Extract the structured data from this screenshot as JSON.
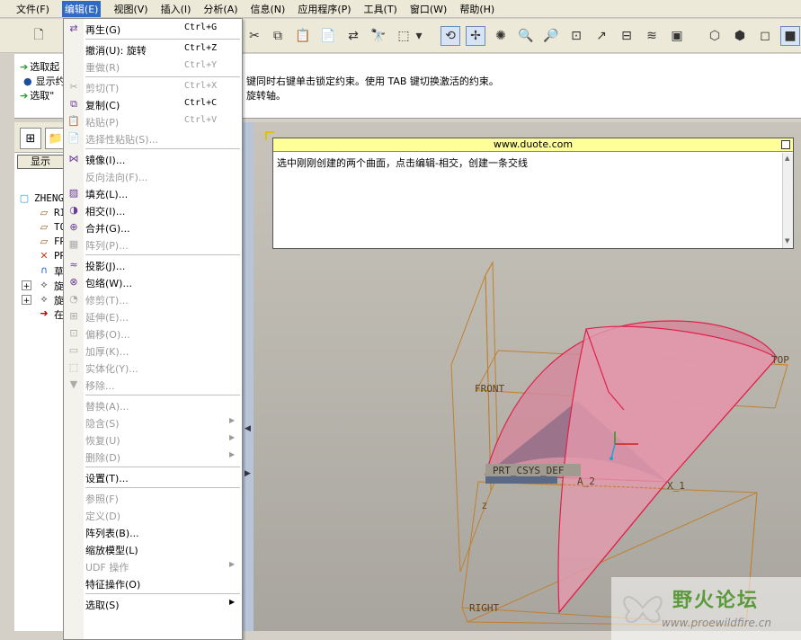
{
  "menubar": {
    "items": [
      "文件(F)",
      "编辑(E)",
      "视图(V)",
      "插入(I)",
      "分析(A)",
      "信息(N)",
      "应用程序(P)",
      "工具(T)",
      "窗口(W)",
      "帮助(H)"
    ],
    "active_index": 1
  },
  "messages": {
    "line1": "选取起",
    "line2": "显示约",
    "line2_tail": "键同时右键单击锁定约束。使用 TAB 键切换激活的约束。",
    "line3": "选取\"",
    "line3_tail": "旋转轴。"
  },
  "left_panel": {
    "show_button": "显示",
    "tree": [
      {
        "label": "ZHENG",
        "icon": "part-icon"
      },
      {
        "label": "RI",
        "icon": "datum-plane-icon"
      },
      {
        "label": "TO",
        "icon": "datum-plane-icon"
      },
      {
        "label": "FR",
        "icon": "datum-plane-icon"
      },
      {
        "label": "PR",
        "icon": "csys-icon"
      },
      {
        "label": "草",
        "icon": "sketch-icon"
      },
      {
        "label": "旋",
        "icon": "revolve-icon"
      },
      {
        "label": "旋",
        "icon": "revolve-icon"
      },
      {
        "label": "在",
        "icon": "insert-here-icon"
      }
    ]
  },
  "edit_menu": {
    "items": [
      {
        "label": "再生(G)",
        "shortcut": "Ctrl+G",
        "enabled": true,
        "icon": "regenerate-icon"
      },
      {
        "separator": true
      },
      {
        "label": "撤消(U):  旋转",
        "shortcut": "Ctrl+Z",
        "enabled": true,
        "icon": ""
      },
      {
        "label": "重做(R)",
        "shortcut": "Ctrl+Y",
        "enabled": false,
        "icon": ""
      },
      {
        "separator": true
      },
      {
        "label": "剪切(T)",
        "shortcut": "Ctrl+X",
        "enabled": false,
        "icon": "cut-icon"
      },
      {
        "label": "复制(C)",
        "shortcut": "Ctrl+C",
        "enabled": true,
        "icon": "copy-icon"
      },
      {
        "label": "粘贴(P)",
        "shortcut": "Ctrl+V",
        "enabled": false,
        "icon": "paste-icon"
      },
      {
        "label": "选择性粘贴(S)...",
        "shortcut": "",
        "enabled": false,
        "icon": "paste-special-icon"
      },
      {
        "separator": true
      },
      {
        "label": "镜像(I)...",
        "shortcut": "",
        "enabled": true,
        "icon": "mirror-icon"
      },
      {
        "label": "反向法向(F)...",
        "shortcut": "",
        "enabled": false,
        "icon": ""
      },
      {
        "label": "填充(L)...",
        "shortcut": "",
        "enabled": true,
        "icon": "fill-icon"
      },
      {
        "label": "相交(I)...",
        "shortcut": "",
        "enabled": true,
        "icon": "intersect-icon"
      },
      {
        "label": "合并(G)...",
        "shortcut": "",
        "enabled": true,
        "icon": "merge-icon"
      },
      {
        "label": "阵列(P)...",
        "shortcut": "",
        "enabled": false,
        "icon": "pattern-icon"
      },
      {
        "separator": true
      },
      {
        "label": "投影(J)...",
        "shortcut": "",
        "enabled": true,
        "icon": "project-icon"
      },
      {
        "label": "包络(W)...",
        "shortcut": "",
        "enabled": true,
        "icon": "wrap-icon"
      },
      {
        "label": "修剪(T)...",
        "shortcut": "",
        "enabled": false,
        "icon": "trim-icon"
      },
      {
        "label": "延伸(E)...",
        "shortcut": "",
        "enabled": false,
        "icon": "extend-icon"
      },
      {
        "label": "偏移(O)...",
        "shortcut": "",
        "enabled": false,
        "icon": "offset-icon"
      },
      {
        "label": "加厚(K)...",
        "shortcut": "",
        "enabled": false,
        "icon": "thicken-icon"
      },
      {
        "label": "实体化(Y)...",
        "shortcut": "",
        "enabled": false,
        "icon": "solidify-icon"
      },
      {
        "label": "移除...",
        "shortcut": "",
        "enabled": false,
        "icon": "remove-icon"
      },
      {
        "separator": true
      },
      {
        "label": "替换(A)...",
        "shortcut": "",
        "enabled": false,
        "icon": ""
      },
      {
        "label": "隐含(S)",
        "shortcut": "",
        "enabled": false,
        "icon": "",
        "submenu": true
      },
      {
        "label": "恢复(U)",
        "shortcut": "",
        "enabled": false,
        "icon": "",
        "submenu": true
      },
      {
        "label": "删除(D)",
        "shortcut": "",
        "enabled": false,
        "icon": "",
        "submenu": true
      },
      {
        "separator": true
      },
      {
        "label": "设置(T)...",
        "shortcut": "",
        "enabled": true,
        "icon": ""
      },
      {
        "separator": true
      },
      {
        "label": "参照(F)",
        "shortcut": "",
        "enabled": false,
        "icon": ""
      },
      {
        "label": "定义(D)",
        "shortcut": "",
        "enabled": false,
        "icon": ""
      },
      {
        "label": "阵列表(B)...",
        "shortcut": "",
        "enabled": true,
        "icon": ""
      },
      {
        "label": "缩放模型(L)",
        "shortcut": "",
        "enabled": true,
        "icon": ""
      },
      {
        "label": "UDF 操作",
        "shortcut": "",
        "enabled": false,
        "icon": "",
        "submenu": true
      },
      {
        "label": "特征操作(O)",
        "shortcut": "",
        "enabled": true,
        "icon": ""
      },
      {
        "separator": true
      },
      {
        "label": "选取(S)",
        "shortcut": "",
        "enabled": true,
        "icon": "",
        "submenu": true
      }
    ]
  },
  "note": {
    "title": "www.duote.com",
    "text": "选中刚刚创建的两个曲面，点击编辑-相交，创建一条交线"
  },
  "scene": {
    "labels": [
      "FRONT",
      "TOP",
      "RIGHT",
      "PRT_CSYS_DEF",
      "A_2",
      "X_1",
      "Z"
    ],
    "colors": {
      "surface": "#d8899c",
      "edge": "#e0204a",
      "datum": "#c08030",
      "background": "#bcb9b1"
    }
  },
  "watermark": {
    "title": "野火论坛",
    "url": "www.proewildfire.cn"
  }
}
